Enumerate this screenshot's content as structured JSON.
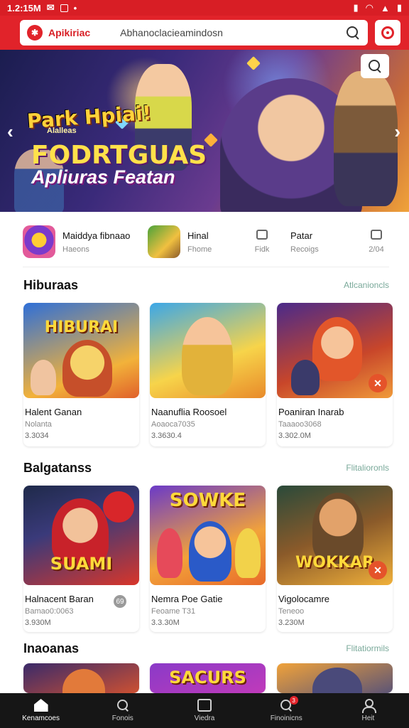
{
  "status_bar": {
    "time": "1.2:15M"
  },
  "app_bar": {
    "logo_text": "Apikiriac",
    "search_placeholder": "Abhanoclacieamindosn"
  },
  "banner": {
    "game_logo": "Park Hpiai!",
    "game_logo_sub": "Alalleas",
    "headline": "FODRTGUAS",
    "subline": "Apliuras Featan",
    "prev_arrow": "‹",
    "next_arrow": "›"
  },
  "quick_links": [
    {
      "name": "Maiddya fibnaao",
      "sub": "Haeons"
    },
    {
      "name": "Hinal",
      "sub": "Fhome"
    },
    {
      "name": "",
      "sub": "Fidk"
    },
    {
      "name": "Patar",
      "sub": "Recoigs"
    },
    {
      "name": "",
      "sub": "2/04"
    }
  ],
  "sections": [
    {
      "title": "Hiburaas",
      "link": "Atlcanioncls",
      "cards": [
        {
          "art_title": "HIBURAI",
          "name": "Halent Ganan",
          "sub": "Nolanta",
          "meta": "3.3034"
        },
        {
          "art_title": "",
          "name": "Naanuflia Roosoel",
          "sub": "Aoaoca7035",
          "meta": "3.3630.4"
        },
        {
          "art_title": "",
          "name": "Poaniran Inarab",
          "sub": "Taaaoo3068",
          "meta": "3.302.0M"
        }
      ]
    },
    {
      "title": "Balgatanss",
      "link": "Flitalioronls",
      "cards": [
        {
          "art_title": "SUAMI",
          "name": "Halnacent Baran",
          "sub": "Bamao0:0063",
          "meta": "3.930M",
          "pill": "69"
        },
        {
          "art_title": "SOWKE",
          "name": "Nemra Poe Gatie",
          "sub": "Feoame T31",
          "meta": "3.3.30M"
        },
        {
          "art_title": "WOKKAR",
          "name": "Vigolocamre",
          "sub": "Teneoo",
          "meta": "3.230M"
        }
      ]
    },
    {
      "title": "Inaoanas",
      "link": "Flitatiormils",
      "cards": [
        {
          "art_title": ""
        },
        {
          "art_title": "SACURS"
        },
        {
          "art_title": ""
        }
      ]
    }
  ],
  "bottom_nav": [
    {
      "label": "Kenamcoes",
      "notif": ""
    },
    {
      "label": "Fonois",
      "notif": ""
    },
    {
      "label": "Viedra",
      "notif": ""
    },
    {
      "label": "Finoinicns",
      "notif": "3"
    },
    {
      "label": "Heit",
      "notif": ""
    }
  ],
  "colors": {
    "brand_red": "#e1232a",
    "link_teal": "#7aa99a",
    "nav_bg": "#161616"
  }
}
